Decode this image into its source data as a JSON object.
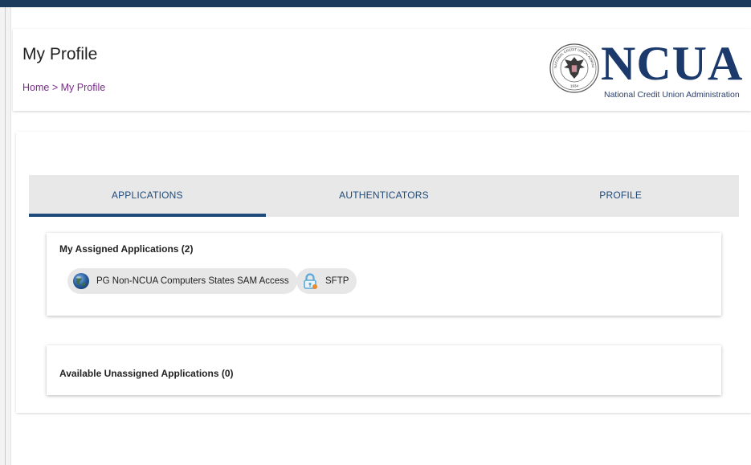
{
  "header": {
    "title": "My Profile",
    "breadcrumb": {
      "home": "Home",
      "separator": ">",
      "current": "My Profile"
    }
  },
  "logo": {
    "wordmark": "NCUA",
    "subtitle": "National Credit Union Administration",
    "seal_text": "NATIONAL CREDIT UNION ADMINISTRATION",
    "seal_year": "1934"
  },
  "tabs": [
    {
      "label": "APPLICATIONS",
      "active": true
    },
    {
      "label": "AUTHENTICATORS",
      "active": false
    },
    {
      "label": "PROFILE",
      "active": false
    }
  ],
  "assigned": {
    "heading": "My Assigned Applications (2)",
    "apps": [
      {
        "label": "PG Non-NCUA Computers States SAM Access",
        "icon": "globe-icon"
      },
      {
        "label": "SFTP",
        "icon": "lock-icon"
      }
    ]
  },
  "unassigned": {
    "heading": "Available Unassigned Applications (0)"
  },
  "colors": {
    "top_bar": "#1b3a5c",
    "accent": "#1e4a7a",
    "breadcrumb_link": "#7a2a8c",
    "logo_navy": "#1b3a6b"
  }
}
